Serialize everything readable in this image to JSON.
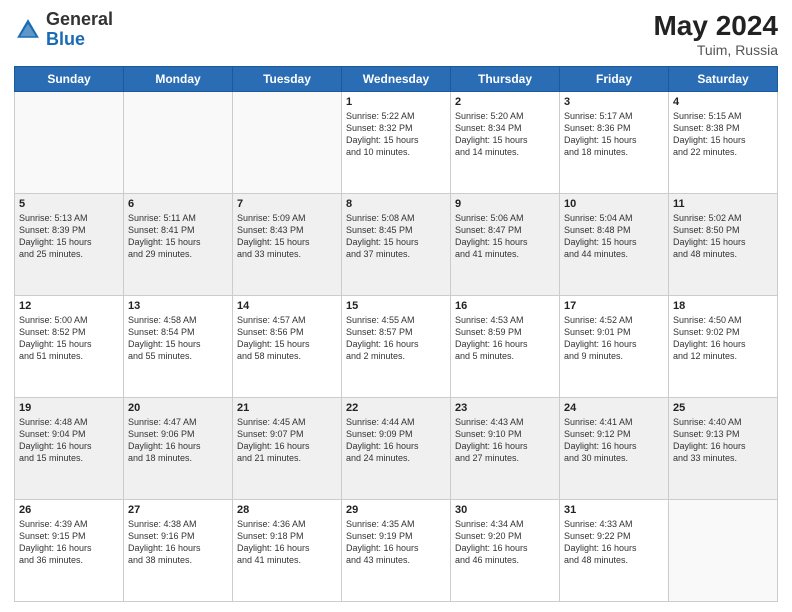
{
  "header": {
    "logo_general": "General",
    "logo_blue": "Blue",
    "month_year": "May 2024",
    "location": "Tuim, Russia"
  },
  "days_of_week": [
    "Sunday",
    "Monday",
    "Tuesday",
    "Wednesday",
    "Thursday",
    "Friday",
    "Saturday"
  ],
  "weeks": [
    [
      {
        "day": "",
        "info": ""
      },
      {
        "day": "",
        "info": ""
      },
      {
        "day": "",
        "info": ""
      },
      {
        "day": "1",
        "info": "Sunrise: 5:22 AM\nSunset: 8:32 PM\nDaylight: 15 hours\nand 10 minutes."
      },
      {
        "day": "2",
        "info": "Sunrise: 5:20 AM\nSunset: 8:34 PM\nDaylight: 15 hours\nand 14 minutes."
      },
      {
        "day": "3",
        "info": "Sunrise: 5:17 AM\nSunset: 8:36 PM\nDaylight: 15 hours\nand 18 minutes."
      },
      {
        "day": "4",
        "info": "Sunrise: 5:15 AM\nSunset: 8:38 PM\nDaylight: 15 hours\nand 22 minutes."
      }
    ],
    [
      {
        "day": "5",
        "info": "Sunrise: 5:13 AM\nSunset: 8:39 PM\nDaylight: 15 hours\nand 25 minutes."
      },
      {
        "day": "6",
        "info": "Sunrise: 5:11 AM\nSunset: 8:41 PM\nDaylight: 15 hours\nand 29 minutes."
      },
      {
        "day": "7",
        "info": "Sunrise: 5:09 AM\nSunset: 8:43 PM\nDaylight: 15 hours\nand 33 minutes."
      },
      {
        "day": "8",
        "info": "Sunrise: 5:08 AM\nSunset: 8:45 PM\nDaylight: 15 hours\nand 37 minutes."
      },
      {
        "day": "9",
        "info": "Sunrise: 5:06 AM\nSunset: 8:47 PM\nDaylight: 15 hours\nand 41 minutes."
      },
      {
        "day": "10",
        "info": "Sunrise: 5:04 AM\nSunset: 8:48 PM\nDaylight: 15 hours\nand 44 minutes."
      },
      {
        "day": "11",
        "info": "Sunrise: 5:02 AM\nSunset: 8:50 PM\nDaylight: 15 hours\nand 48 minutes."
      }
    ],
    [
      {
        "day": "12",
        "info": "Sunrise: 5:00 AM\nSunset: 8:52 PM\nDaylight: 15 hours\nand 51 minutes."
      },
      {
        "day": "13",
        "info": "Sunrise: 4:58 AM\nSunset: 8:54 PM\nDaylight: 15 hours\nand 55 minutes."
      },
      {
        "day": "14",
        "info": "Sunrise: 4:57 AM\nSunset: 8:56 PM\nDaylight: 15 hours\nand 58 minutes."
      },
      {
        "day": "15",
        "info": "Sunrise: 4:55 AM\nSunset: 8:57 PM\nDaylight: 16 hours\nand 2 minutes."
      },
      {
        "day": "16",
        "info": "Sunrise: 4:53 AM\nSunset: 8:59 PM\nDaylight: 16 hours\nand 5 minutes."
      },
      {
        "day": "17",
        "info": "Sunrise: 4:52 AM\nSunset: 9:01 PM\nDaylight: 16 hours\nand 9 minutes."
      },
      {
        "day": "18",
        "info": "Sunrise: 4:50 AM\nSunset: 9:02 PM\nDaylight: 16 hours\nand 12 minutes."
      }
    ],
    [
      {
        "day": "19",
        "info": "Sunrise: 4:48 AM\nSunset: 9:04 PM\nDaylight: 16 hours\nand 15 minutes."
      },
      {
        "day": "20",
        "info": "Sunrise: 4:47 AM\nSunset: 9:06 PM\nDaylight: 16 hours\nand 18 minutes."
      },
      {
        "day": "21",
        "info": "Sunrise: 4:45 AM\nSunset: 9:07 PM\nDaylight: 16 hours\nand 21 minutes."
      },
      {
        "day": "22",
        "info": "Sunrise: 4:44 AM\nSunset: 9:09 PM\nDaylight: 16 hours\nand 24 minutes."
      },
      {
        "day": "23",
        "info": "Sunrise: 4:43 AM\nSunset: 9:10 PM\nDaylight: 16 hours\nand 27 minutes."
      },
      {
        "day": "24",
        "info": "Sunrise: 4:41 AM\nSunset: 9:12 PM\nDaylight: 16 hours\nand 30 minutes."
      },
      {
        "day": "25",
        "info": "Sunrise: 4:40 AM\nSunset: 9:13 PM\nDaylight: 16 hours\nand 33 minutes."
      }
    ],
    [
      {
        "day": "26",
        "info": "Sunrise: 4:39 AM\nSunset: 9:15 PM\nDaylight: 16 hours\nand 36 minutes."
      },
      {
        "day": "27",
        "info": "Sunrise: 4:38 AM\nSunset: 9:16 PM\nDaylight: 16 hours\nand 38 minutes."
      },
      {
        "day": "28",
        "info": "Sunrise: 4:36 AM\nSunset: 9:18 PM\nDaylight: 16 hours\nand 41 minutes."
      },
      {
        "day": "29",
        "info": "Sunrise: 4:35 AM\nSunset: 9:19 PM\nDaylight: 16 hours\nand 43 minutes."
      },
      {
        "day": "30",
        "info": "Sunrise: 4:34 AM\nSunset: 9:20 PM\nDaylight: 16 hours\nand 46 minutes."
      },
      {
        "day": "31",
        "info": "Sunrise: 4:33 AM\nSunset: 9:22 PM\nDaylight: 16 hours\nand 48 minutes."
      },
      {
        "day": "",
        "info": ""
      }
    ]
  ]
}
